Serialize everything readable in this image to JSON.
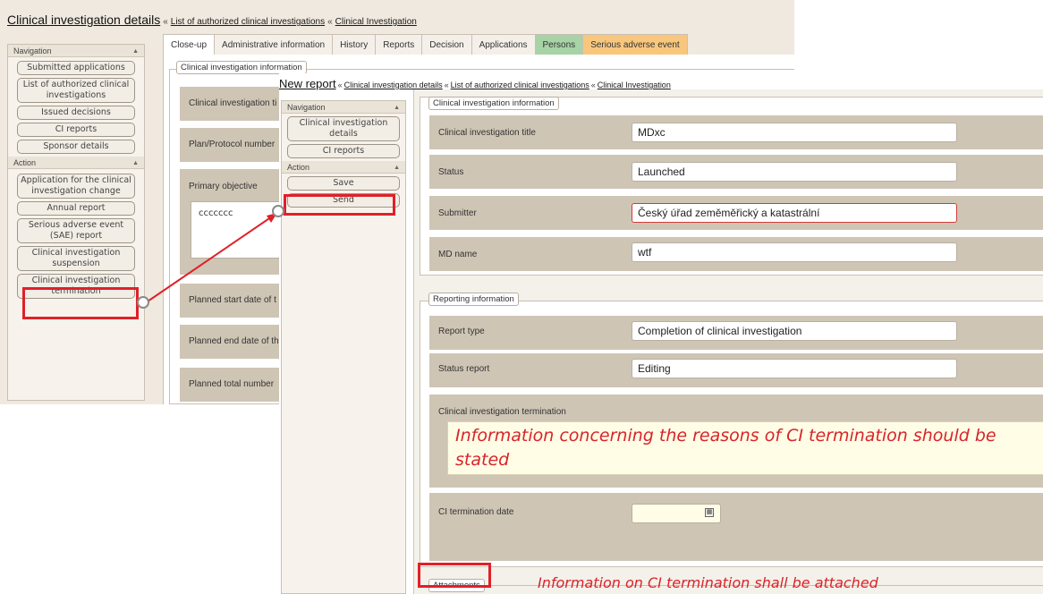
{
  "back": {
    "title": "Clinical investigation details",
    "sep": "«",
    "breadcrumbs": [
      "List of authorized clinical investigations",
      "Clinical Investigation"
    ],
    "navigation_header": "Navigation",
    "action_header": "Action",
    "nav_items": [
      "Submitted applications",
      "List of authorized clinical investigations",
      "Issued decisions",
      "CI reports",
      "Sponsor details"
    ],
    "action_items": [
      "Application for the clinical investigation change",
      "Annual report",
      "Serious adverse event (SAE) report",
      "Clinical investigation suspension",
      "Clinical investigation termination"
    ],
    "tabs": [
      "Close-up",
      "Administrative information",
      "History",
      "Reports",
      "Decision",
      "Applications",
      "Persons",
      "Serious adverse event"
    ],
    "section_legend": "Clinical investigation information",
    "rows": [
      "Clinical investigation ti",
      "Plan/Protocol number",
      "Primary objective",
      "Planned start date of t",
      "Planned end date of th",
      "Planned total number"
    ],
    "objective_value": "ccccccc"
  },
  "front": {
    "title": "New report",
    "sep": "«",
    "breadcrumbs": [
      "Clinical investigation details",
      "List of authorized clinical investigations",
      "Clinical Investigation"
    ],
    "navigation_header": "Navigation",
    "action_header": "Action",
    "nav_items": [
      "Clinical investigation details",
      "CI reports"
    ],
    "action_items": [
      "Save",
      "Send"
    ],
    "ci_legend": "Clinical investigation information",
    "ci_fields": [
      {
        "label": "Clinical investigation title",
        "value": "MDxc"
      },
      {
        "label": "Status",
        "value": "Launched"
      },
      {
        "label": "Submitter",
        "value": "Český úřad zeměměřický a katastrální"
      },
      {
        "label": "MD name",
        "value": "wtf"
      }
    ],
    "rep_legend": "Reporting information",
    "rep_fields": [
      {
        "label": "Report type",
        "value": "Completion of clinical investigation"
      },
      {
        "label": "Status report",
        "value": "Editing"
      }
    ],
    "termination_label": "Clinical investigation termination",
    "termination_text": "Information concerning the reasons of CI termination should be stated",
    "date_label": "CI termination date",
    "date_value": "",
    "attachments_label": "Attachments",
    "attach_note": "Information on CI termination shall be attached"
  },
  "colors": {
    "annotation_red": "#e0202a",
    "panel_tan": "#cfc5b5",
    "tab_green": "#a7d3a6",
    "tab_orange": "#f8c77d",
    "highlight_yellow": "#fffde6"
  }
}
